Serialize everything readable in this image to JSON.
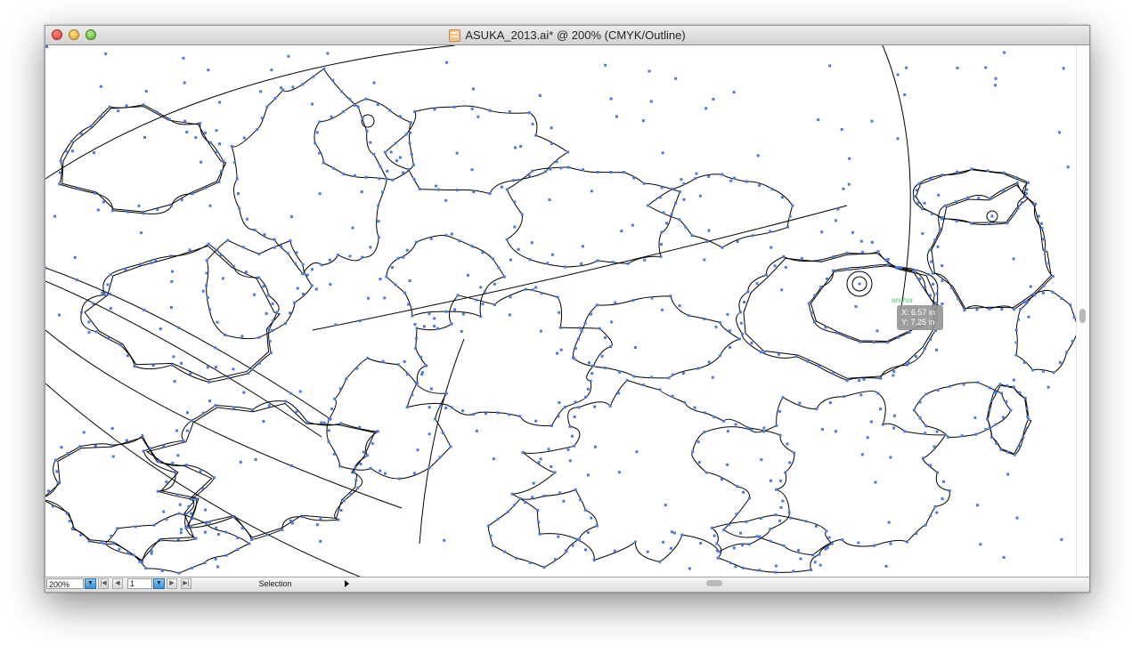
{
  "window": {
    "title": "ASUKA_2013.ai* @ 200% (CMYK/Outline)",
    "document_icon": "illustrator-document-icon"
  },
  "canvas": {
    "mode": "outline",
    "path_color": "#000000",
    "anchor_color": "#4a7bdc",
    "smart_guide": {
      "label": "anchor",
      "x_readout": "X: 6.57 in",
      "y_readout": "Y: 7.25 in",
      "label_color": "#3fcf6a"
    }
  },
  "statusbar": {
    "zoom_value": "200%",
    "page_value": "1",
    "status_text": "Selection",
    "dropdown_icon": "triangle-down-icon",
    "first_icon": "first-page-icon",
    "prev_icon": "previous-page-icon",
    "next_icon": "next-page-icon",
    "last_icon": "last-page-icon",
    "menu_icon": "triangle-right-icon"
  }
}
